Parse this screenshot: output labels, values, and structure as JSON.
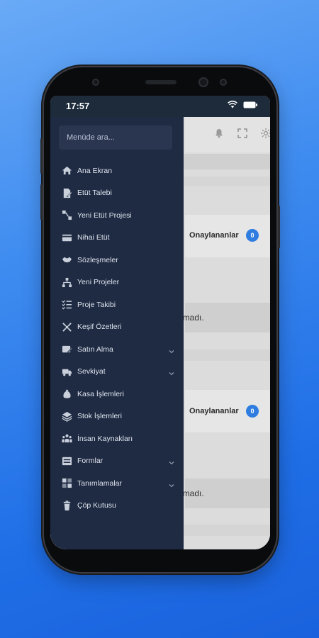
{
  "status_bar": {
    "time": "17:57"
  },
  "search": {
    "placeholder": "Menüde ara..."
  },
  "menu": [
    {
      "label": "Ana Ekran",
      "icon": "home-icon",
      "has_submenu": false
    },
    {
      "label": "Etüt Talebi",
      "icon": "document-edit-icon",
      "has_submenu": false
    },
    {
      "label": "Yeni Etüt Projesi",
      "icon": "project-nodes-icon",
      "has_submenu": false
    },
    {
      "label": "Nihai Etüt",
      "icon": "card-icon",
      "has_submenu": false
    },
    {
      "label": "Sözleşmeler",
      "icon": "handshake-icon",
      "has_submenu": false
    },
    {
      "label": "Yeni Projeler",
      "icon": "sitemap-icon",
      "has_submenu": false
    },
    {
      "label": "Proje Takibi",
      "icon": "checklist-icon",
      "has_submenu": false
    },
    {
      "label": "Keşif Özetleri",
      "icon": "grid-arrows-icon",
      "has_submenu": false
    },
    {
      "label": "Satın Alma",
      "icon": "pencil-card-icon",
      "has_submenu": true
    },
    {
      "label": "Sevkiyat",
      "icon": "truck-icon",
      "has_submenu": true
    },
    {
      "label": "Kasa İşlemleri",
      "icon": "money-bag-icon",
      "has_submenu": false
    },
    {
      "label": "Stok İşlemleri",
      "icon": "layers-icon",
      "has_submenu": false
    },
    {
      "label": "İnsan Kaynakları",
      "icon": "users-icon",
      "has_submenu": false
    },
    {
      "label": "Formlar",
      "icon": "form-icon",
      "has_submenu": true
    },
    {
      "label": "Tanımlamalar",
      "icon": "tiles-icon",
      "has_submenu": true
    },
    {
      "label": "Çöp Kutusu",
      "icon": "trash-icon",
      "has_submenu": false
    }
  ],
  "background": {
    "cards": [
      {
        "label": "Onaylananlar",
        "count": "0"
      },
      {
        "label": "Onaylananlar",
        "count": "0"
      }
    ],
    "messages": [
      "amadı.",
      "amadı."
    ]
  }
}
